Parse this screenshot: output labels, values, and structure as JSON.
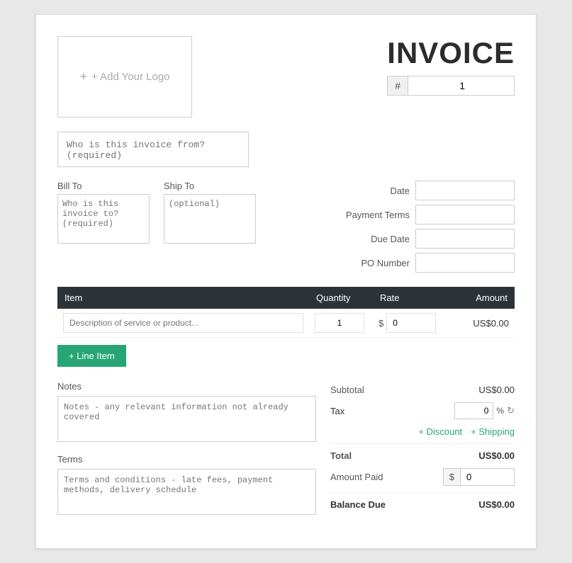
{
  "header": {
    "logo_placeholder": "+ Add Your Logo",
    "title": "INVOICE",
    "number_label": "#",
    "number_value": "1"
  },
  "from": {
    "placeholder": "Who is this invoice from? (required)"
  },
  "bill_to": {
    "label": "Bill To",
    "placeholder": "Who is this invoice to? (required)"
  },
  "ship_to": {
    "label": "Ship To",
    "placeholder": "(optional)"
  },
  "date_fields": [
    {
      "label": "Date",
      "value": ""
    },
    {
      "label": "Payment Terms",
      "value": ""
    },
    {
      "label": "Due Date",
      "value": ""
    },
    {
      "label": "PO Number",
      "value": ""
    }
  ],
  "table": {
    "columns": [
      "Item",
      "Quantity",
      "Rate",
      "Amount"
    ],
    "row": {
      "description_placeholder": "Description of service or product...",
      "quantity": "1",
      "rate_symbol": "$",
      "rate_value": "0",
      "amount": "US$0.00"
    }
  },
  "add_line_btn": "+ Line Item",
  "notes": {
    "label": "Notes",
    "placeholder": "Notes - any relevant information not already covered"
  },
  "terms": {
    "label": "Terms",
    "placeholder": "Terms and conditions - late fees, payment methods, delivery schedule"
  },
  "totals": {
    "subtotal_label": "Subtotal",
    "subtotal_value": "US$0.00",
    "tax_label": "Tax",
    "tax_value": "0",
    "tax_pct": "%",
    "discount_btn": "+ Discount",
    "shipping_btn": "+ Shipping",
    "total_label": "Total",
    "total_value": "US$0.00",
    "amount_paid_label": "Amount Paid",
    "amount_paid_symbol": "$",
    "amount_paid_value": "0",
    "balance_due_label": "Balance Due",
    "balance_due_value": "US$0.00"
  }
}
